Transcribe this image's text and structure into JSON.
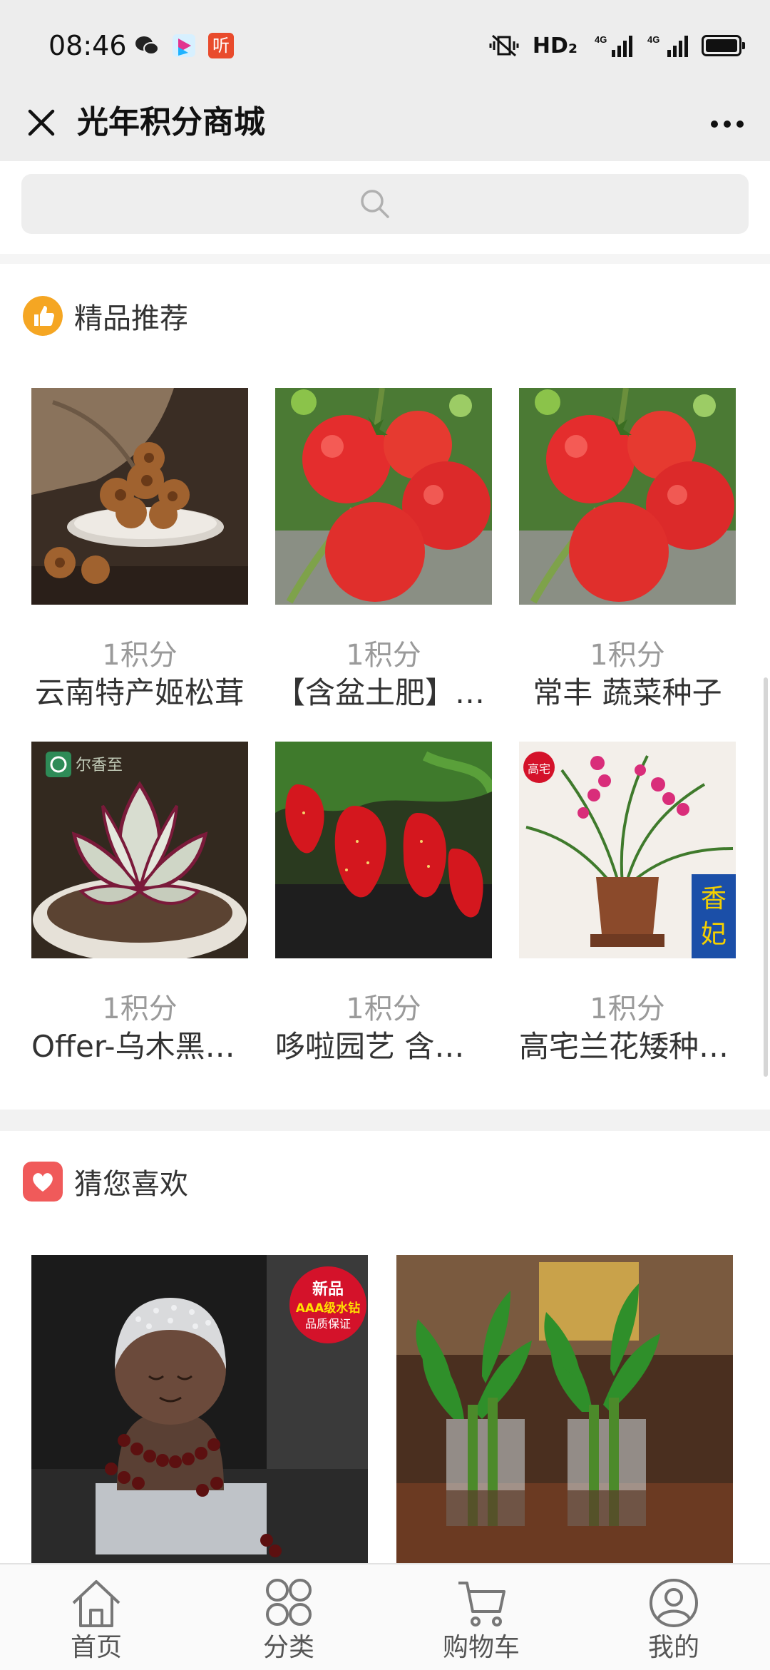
{
  "status_bar": {
    "time": "08:46",
    "listen_icon_text": "听",
    "hd_text": "HD₂",
    "signal1_label": "4G",
    "signal2_label": "4G"
  },
  "header": {
    "title": "光年积分商城"
  },
  "search": {
    "placeholder": ""
  },
  "sections": {
    "featured_title": "精品推荐",
    "guess_title": "猜您喜欢"
  },
  "featured": [
    {
      "price": "1积分",
      "name": "云南特产姬松茸"
    },
    {
      "price": "1积分",
      "name": "【含盆土肥】番茄苗"
    },
    {
      "price": "1积分",
      "name": "常丰 蔬菜种子"
    },
    {
      "price": "1积分",
      "name": "Offer-乌木黑多肉"
    },
    {
      "price": "1积分",
      "name": "哆啦园艺 含盆土"
    },
    {
      "price": "1积分",
      "name": "高宅兰花矮种盆栽"
    }
  ],
  "guess": [
    {
      "badge_line1": "新品",
      "badge_line2": "AAA级水钻",
      "badge_line3": "品质保证"
    },
    {}
  ],
  "product_overlays": {
    "succulent_watermark": "尔香至",
    "orchid_stamp": "高宅",
    "orchid_banner_1": "香",
    "orchid_banner_2": "妃"
  },
  "bottom_nav": [
    {
      "label": "首页",
      "icon": "home-icon"
    },
    {
      "label": "分类",
      "icon": "category-icon"
    },
    {
      "label": "购物车",
      "icon": "cart-icon"
    },
    {
      "label": "我的",
      "icon": "profile-icon"
    }
  ],
  "colors": {
    "featured_icon": "#f5a623",
    "guess_icon": "#f05a5a",
    "badge_red": "#d4122a"
  }
}
